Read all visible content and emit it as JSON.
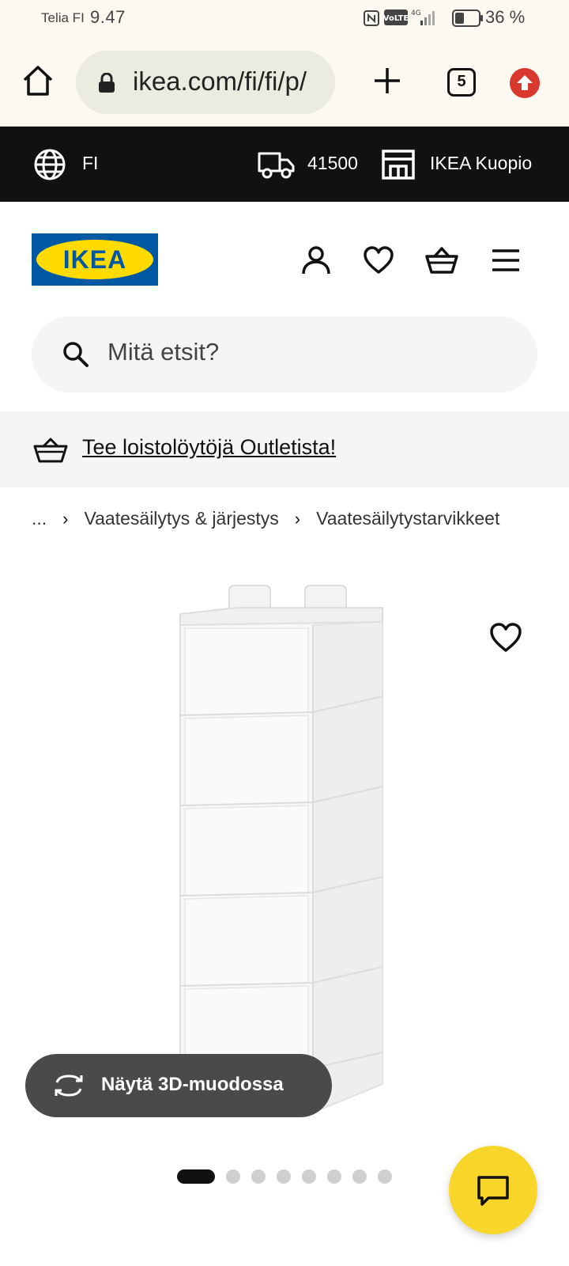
{
  "status_bar": {
    "carrier": "Telia FI",
    "time": "9.47",
    "network": "4G",
    "volte": "VoLTE",
    "battery": "36 %"
  },
  "browser": {
    "url": "ikea.com/fi/fi/p/",
    "tab_count": "5"
  },
  "top_strip": {
    "language": "FI",
    "postal_code": "41500",
    "store": "IKEA Kuopio"
  },
  "header": {
    "logo_text": "IKEA",
    "brand_blue": "#0058a3",
    "brand_yellow": "#ffdb00"
  },
  "search": {
    "placeholder": "Mitä etsit?"
  },
  "promo": {
    "link_text": "Tee loistolöytöjä Outletista!"
  },
  "breadcrumb": {
    "items": [
      "...",
      "Vaatesäilytys & järjestys",
      "Vaatesäilytystarvikkeet"
    ]
  },
  "product": {
    "view_3d_label": "Näytä 3D-muodossa",
    "image_count": 8,
    "active_image": 1
  },
  "colors": {
    "chat_fab": "#f7d629",
    "update_button": "#d8382e",
    "top_strip": "#111111"
  }
}
